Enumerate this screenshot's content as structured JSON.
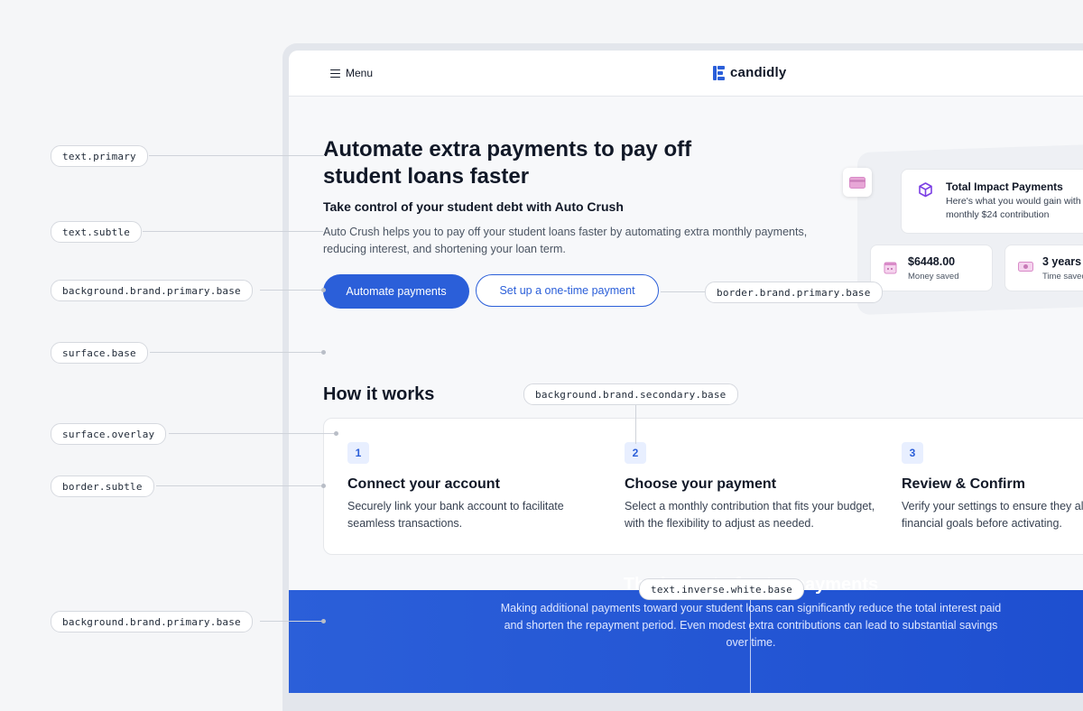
{
  "header": {
    "menu_label": "Menu",
    "logo_text": "candidly"
  },
  "hero": {
    "title": "Automate extra payments to pay off student loans faster",
    "subtitle": "Take control of your student debt with Auto Crush",
    "description": "Auto Crush helps you to pay off your student loans faster by automating extra monthly payments, reducing interest, and shortening your loan term.",
    "primary_button": "Automate payments",
    "secondary_button": "Set up a one-time payment"
  },
  "impact_preview": {
    "title": "Total Impact Payments",
    "text": "Here's what you would gain with monthly $24 contribution",
    "stats": [
      {
        "value": "$6448.00",
        "label": "Money saved",
        "icon": "calendar-icon"
      },
      {
        "value": "3 years",
        "label": "Time saved",
        "icon": "cash-icon"
      }
    ],
    "icons": {
      "card": "credit-card-icon",
      "cube": "cube-icon"
    }
  },
  "how_it_works": {
    "title": "How it works",
    "steps": [
      {
        "number": "1",
        "title": "Connect your account",
        "description": "Securely link your bank account to facilitate seamless transactions."
      },
      {
        "number": "2",
        "title": "Choose your payment",
        "description": "Select a monthly contribution that fits your budget, with the flexibility to adjust as needed."
      },
      {
        "number": "3",
        "title": "Review & Confirm",
        "description": "Verify your settings to ensure they align with your financial goals before activating."
      }
    ]
  },
  "impact_section": {
    "title": "The impact of extra payments",
    "description": "Making additional payments toward your student loans can significantly reduce the total interest paid and shorten the repayment period. Even modest extra contributions can lead to substantial savings over time."
  },
  "annotations": {
    "text_primary": "text.primary",
    "text_subtle": "text.subtle",
    "bg_brand_primary_1": "background.brand.primary.base",
    "surface_base": "surface.base",
    "surface_overlay": "surface.overlay",
    "border_subtle": "border.subtle",
    "bg_brand_primary_2": "background.brand.primary.base",
    "border_brand_primary": "border.brand.primary.base",
    "bg_brand_secondary": "background.brand.secondary.base",
    "text_inverse_white": "text.inverse.white.base"
  },
  "colors": {
    "brand_primary": "#2b5fd9",
    "brand_secondary": "#e8efff",
    "surface_base": "#f7f8fa",
    "surface_overlay": "#ffffff",
    "border_subtle": "#e5e7eb",
    "text_primary": "#111827",
    "text_subtle": "#4b5563"
  }
}
